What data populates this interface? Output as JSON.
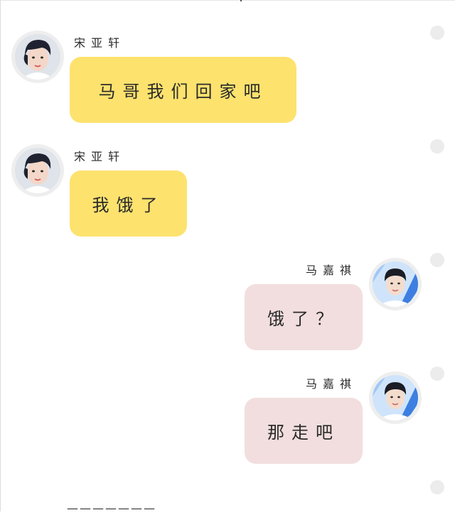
{
  "messages": [
    {
      "sender": "宋亚轩",
      "text": "马哥我们回家吧",
      "side": "left",
      "bubble_color": "#fde26e"
    },
    {
      "sender": "宋亚轩",
      "text": "我饿了",
      "side": "left",
      "bubble_color": "#fde26e"
    },
    {
      "sender": "马嘉祺",
      "text": "饿了？",
      "side": "right",
      "bubble_color": "#f2dede"
    },
    {
      "sender": "马嘉祺",
      "text": "那走吧",
      "side": "right",
      "bubble_color": "#f2dede"
    }
  ],
  "separator": "———————",
  "icons": {
    "avatar_left": "avatar-boy-dark-hair-icon",
    "avatar_right": "avatar-boy-blue-background-icon",
    "select": "select-circle-icon"
  }
}
